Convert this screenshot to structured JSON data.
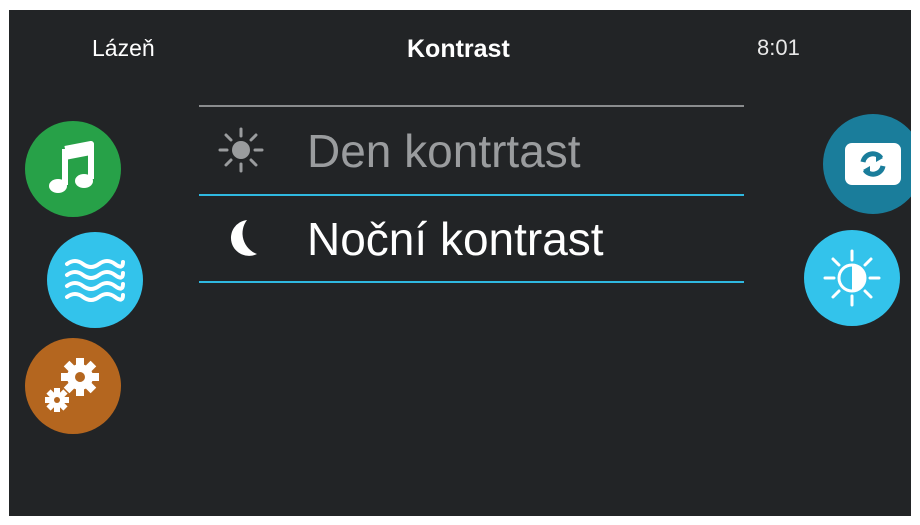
{
  "header": {
    "location": "Lázeň",
    "title": "Kontrast",
    "time": "8:01"
  },
  "left_nav": {
    "items": [
      {
        "icon": "music-note-icon",
        "color": "#27a148"
      },
      {
        "icon": "water-waves-icon",
        "color": "#33c3eb"
      },
      {
        "icon": "gears-icon",
        "color": "#b4661f"
      }
    ]
  },
  "right_nav": {
    "items": [
      {
        "icon": "switch-refresh-icon",
        "color": "#1a7d9b"
      },
      {
        "icon": "contrast-sun-icon",
        "color": "#33c3eb"
      }
    ]
  },
  "menu": {
    "items": [
      {
        "label": "Den kontrtast",
        "icon": "sun-icon",
        "selected": false
      },
      {
        "label": "Noční kontrast",
        "icon": "moon-icon",
        "selected": true
      }
    ],
    "accent_color": "#2fb8e0"
  }
}
